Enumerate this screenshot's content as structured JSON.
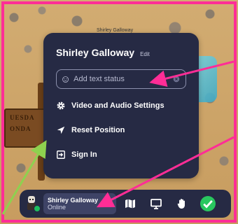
{
  "map": {
    "sign_text_1": "UESDA",
    "sign_text_2": "ONDA",
    "caption": "Shirley Galloway"
  },
  "menu": {
    "user_name": "Shirley Galloway",
    "edit_label": "Edit",
    "status_placeholder": "Add text status",
    "items": [
      {
        "label": "Video and Audio Settings",
        "icon": "gear-icon"
      },
      {
        "label": "Reset Position",
        "icon": "location-arrow-icon"
      },
      {
        "label": "Sign In",
        "icon": "sign-in-icon"
      }
    ]
  },
  "bar": {
    "user_name": "Shirley Galloway",
    "user_status": "Online",
    "buttons": [
      "map-icon",
      "screen-share-icon",
      "raise-hand-icon",
      "check-icon"
    ]
  },
  "colors": {
    "annotation_pink": "#ff2d96",
    "annotation_green": "#8ed14f",
    "panel": "#262a44",
    "online": "#1fbf5f"
  }
}
